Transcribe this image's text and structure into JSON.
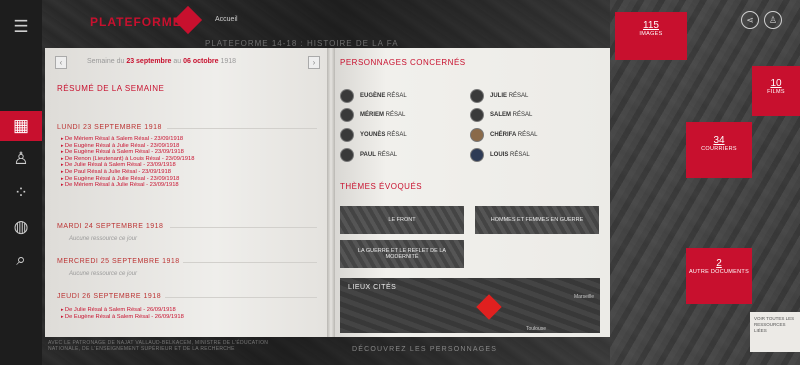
{
  "header": {
    "brand": "PLATEFORME",
    "nav_text": "Accueil",
    "faded_title": "PLATEFORME 14-18 : HISTOIRE DE LA FA"
  },
  "sidebar": {
    "items": [
      {
        "name": "menu-icon",
        "glyph": "☰"
      },
      {
        "name": "calendar-icon",
        "glyph": "▦"
      },
      {
        "name": "people-icon",
        "glyph": "♙"
      },
      {
        "name": "dots-icon",
        "glyph": "⁘"
      },
      {
        "name": "globe-icon",
        "glyph": "◍"
      },
      {
        "name": "search-icon",
        "glyph": "⌕"
      }
    ]
  },
  "book": {
    "week_nav": {
      "prev": "‹",
      "next": "›",
      "text_pre": "Semaine du ",
      "start": "23 septembre",
      "text_mid": " au ",
      "end": "06 octobre",
      "year": " 1918"
    },
    "summary_title": "RÉSUMÉ DE LA SEMAINE",
    "days": [
      {
        "title": "LUNDI 23 SEPTEMBRE 1918",
        "events": [
          "De Mériem Résal à Salem Résal - 23/09/1918",
          "De Eugène Résal à Julie Résal - 23/09/1918",
          "De Eugène Résal à Salem Résal - 23/09/1918",
          "De Renon (Lieutenant) à Louis Résal - 23/09/1918",
          "De Julie Résal à Salem Résal - 23/09/1918",
          "De Paul Résal à Julie Résal - 23/09/1918",
          "De Eugène Résal à Julie Résal - 23/09/1918",
          "De Mériem Résal à Julie Résal - 23/09/1918"
        ]
      },
      {
        "title": "MARDI 24 SEPTEMBRE 1918",
        "note": "Aucune ressource ce jour"
      },
      {
        "title": "MERCREDI 25 SEPTEMBRE 1918",
        "note": "Aucune ressource ce jour"
      },
      {
        "title": "JEUDI 26 SEPTEMBRE 1918",
        "events": [
          "De Julie Résal à Salem Résal - 26/09/1918",
          "De Eugène Résal à Salem Résal - 26/09/1918"
        ]
      }
    ],
    "persons_title": "PERSONNAGES CONCERNÉS",
    "persons": [
      {
        "first": "EUGÈNE",
        "last": "RÉSAL"
      },
      {
        "first": "JULIE",
        "last": "RÉSAL"
      },
      {
        "first": "MÉRIEM",
        "last": "RÉSAL"
      },
      {
        "first": "SALEM",
        "last": "RÉSAL"
      },
      {
        "first": "YOUNÈS",
        "last": "RÉSAL"
      },
      {
        "first": "CHÉRIFA",
        "last": "RÉSAL"
      },
      {
        "first": "PAUL",
        "last": "RÉSAL"
      },
      {
        "first": "LOUIS",
        "last": "RÉSAL"
      }
    ],
    "themes_title": "THÈMES ÉVOQUÉS",
    "themes": [
      "LE FRONT",
      "HOMMES ET FEMMES EN GUERRE",
      "LA GUERRE ET LE REFLET DE LA MODERNITÉ"
    ],
    "lieux": {
      "title": "LIEUX CITÉS",
      "city1": "Marseille",
      "city2": "Toulouse"
    }
  },
  "stats": [
    {
      "num": "115",
      "label": "IMAGES"
    },
    {
      "num": "10",
      "label": "FILMS"
    },
    {
      "num": "34",
      "label": "COURRIERS"
    },
    {
      "num": "2",
      "label": "AUTRE DOCUMENTS"
    }
  ],
  "white_card": "VOIR TOUTES LES RESSOURCES LIÉES",
  "footer": {
    "text": "AVEC LE PATRONAGE DE NAJAT VALLAUD-BELKACEM, MINISTRE DE L'ÉDUCATION NATIONALE, DE L'ENSEIGNEMENT SUPÉRIEUR ET DE LA RECHERCHE",
    "cta": "DÉCOUVREZ LES PERSONNAGES"
  },
  "colors": {
    "accent": "#c8102e",
    "page": "#efeeeb",
    "dark": "#1d1d1d"
  }
}
